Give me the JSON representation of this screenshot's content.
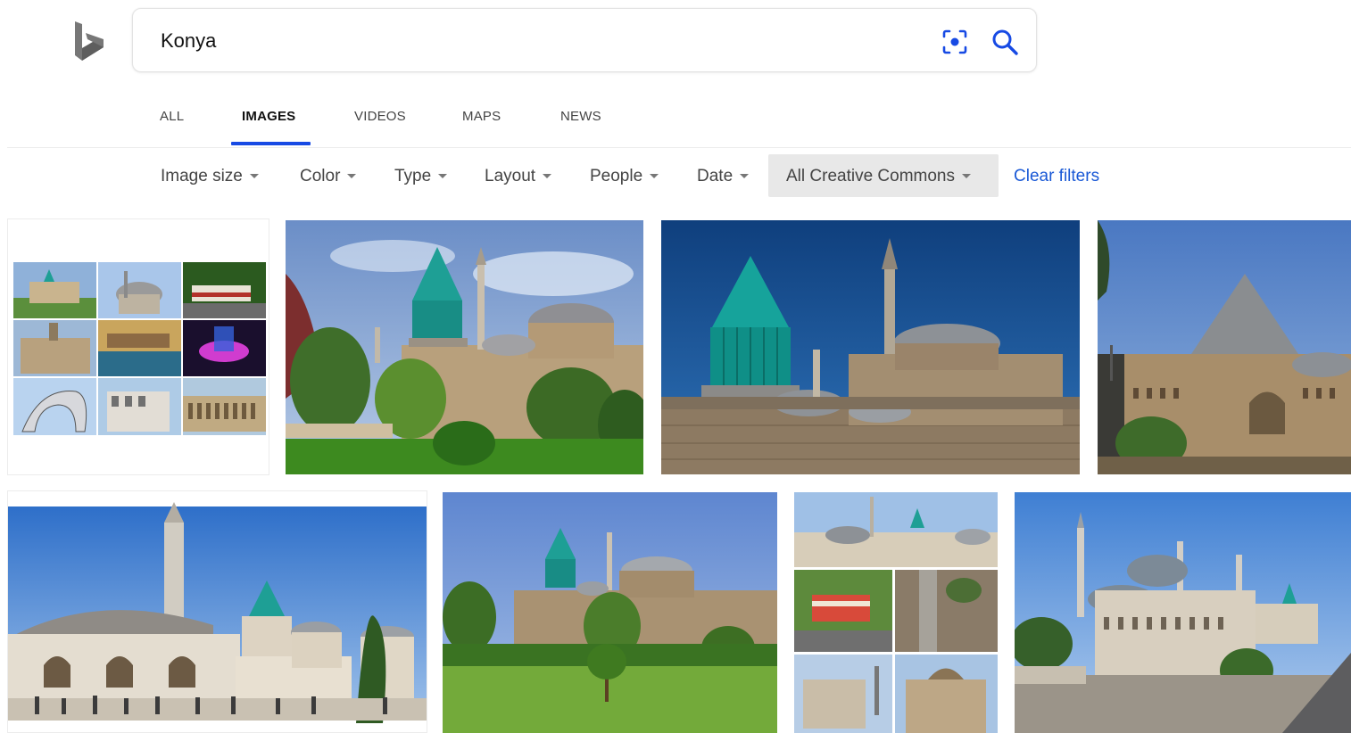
{
  "search": {
    "query": "Konya",
    "placeholder": ""
  },
  "tabs": [
    {
      "label": "ALL",
      "active": false
    },
    {
      "label": "IMAGES",
      "active": true
    },
    {
      "label": "VIDEOS",
      "active": false
    },
    {
      "label": "MAPS",
      "active": false
    },
    {
      "label": "NEWS",
      "active": false
    }
  ],
  "filters": [
    {
      "label": "Image size"
    },
    {
      "label": "Color"
    },
    {
      "label": "Type"
    },
    {
      "label": "Layout"
    },
    {
      "label": "People"
    },
    {
      "label": "Date"
    },
    {
      "label": "All Creative Commons",
      "active": true
    }
  ],
  "clear_filters": "Clear filters",
  "colors": {
    "accent": "#174ae4",
    "link": "#1a59d6",
    "turquoise": "#1e9f95"
  },
  "icons": [
    "bing-logo-icon",
    "visual-search-icon",
    "search-icon",
    "caret-down-icon"
  ],
  "results": [
    {
      "subject": "Konya collage"
    },
    {
      "subject": "Mevlana Museum with green dome"
    },
    {
      "subject": "Mevlana Museum turquoise dome close-up"
    },
    {
      "subject": "Pyramidal tomb building"
    },
    {
      "subject": "Mevlana complex panorama"
    },
    {
      "subject": "Mevlana Museum from garden"
    },
    {
      "subject": "Konya collage vertical"
    },
    {
      "subject": "Selimiye mosque aerial"
    }
  ]
}
